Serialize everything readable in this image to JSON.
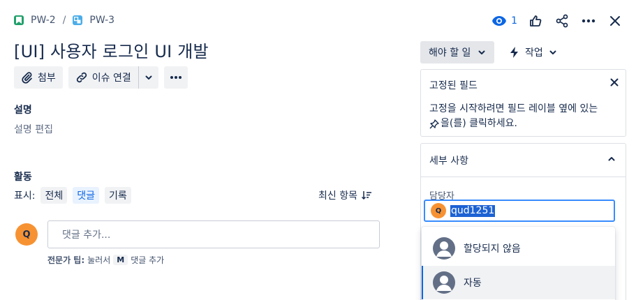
{
  "breadcrumb": {
    "parent": "PW-2",
    "separator": "/",
    "current": "PW-3"
  },
  "header": {
    "watchers_count": "1"
  },
  "issue": {
    "title": "[UI] 사용자 로그인 UI 개발"
  },
  "toolbar": {
    "attach_label": "첨부",
    "link_label": "이슈 연결"
  },
  "description": {
    "heading": "설명",
    "placeholder": "설명 편집"
  },
  "activity": {
    "heading": "활동",
    "show_label": "표시:",
    "filters": [
      "전체",
      "댓글",
      "기록"
    ],
    "active_filter": "댓글",
    "sort_label": "최신 항목",
    "user_initial": "Q",
    "comment_placeholder": "댓글 추가...",
    "tip_prefix": "전문가 팁:",
    "tip_press": "눌러서",
    "tip_key": "M",
    "tip_suffix": "댓글 추가"
  },
  "status": {
    "label": "해야 할 일"
  },
  "actions": {
    "label": "작업"
  },
  "pinned_fields": {
    "title": "고정된 필드",
    "body_line1": "고정을 시작하려면 필드 레이블 옆에 있는",
    "body_line2": "을(를) 클릭하세요."
  },
  "details": {
    "title": "세부 사항",
    "assignee_label": "담당자",
    "assignee_value": "qud1251",
    "assignee_initial": "Q"
  },
  "assignee_options": [
    "할당되지 않음",
    "자동"
  ],
  "colors": {
    "accent": "#0c66e4",
    "avatar": "#f79232",
    "story": "#22a06b",
    "subtask": "#4bade8"
  }
}
